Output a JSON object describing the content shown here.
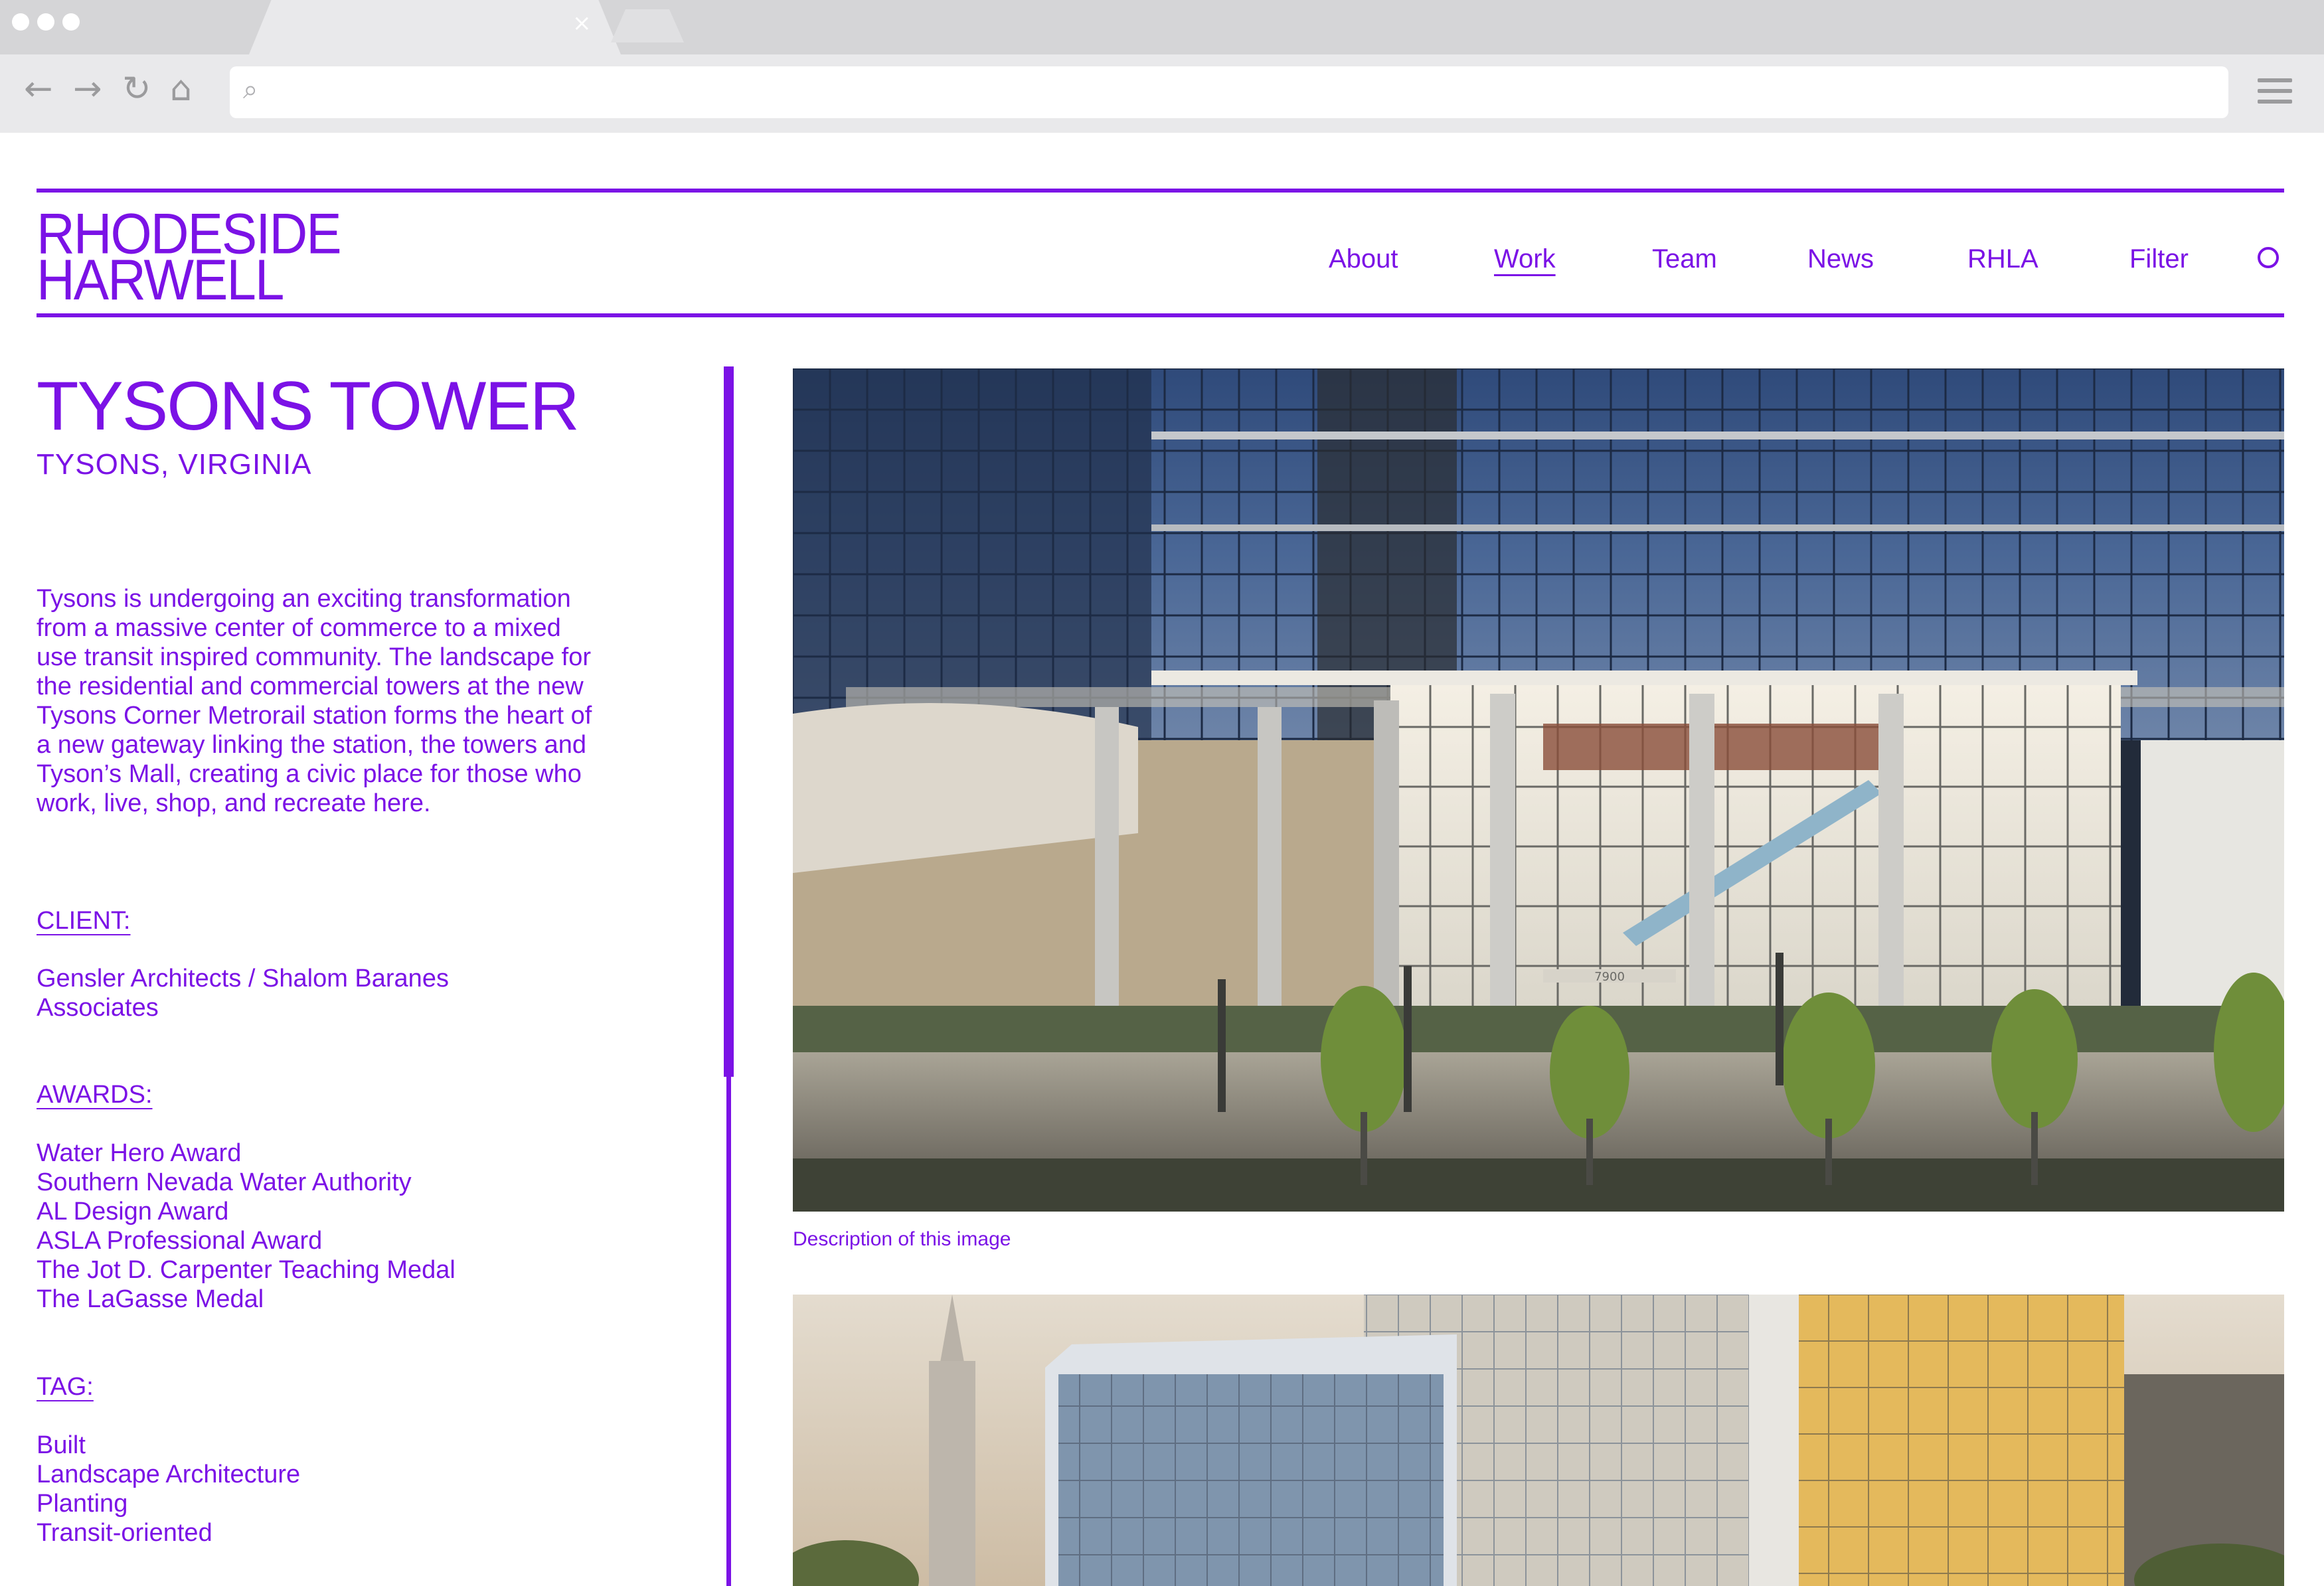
{
  "browser": {
    "tab_close": "×",
    "url_value": "",
    "icons": [
      "back-arrow-icon",
      "forward-arrow-icon",
      "reload-icon",
      "home-icon",
      "search-icon",
      "hamburger-menu-icon"
    ]
  },
  "site": {
    "brand_color": "#7b12e6",
    "logo_line1": "RHODESIDE",
    "logo_line2": "HARWELL",
    "nav": [
      "About",
      "Work",
      "Team",
      "News",
      "RHLA",
      "Filter"
    ],
    "nav_active": "Work"
  },
  "project": {
    "title": "TYSONS TOWER",
    "location": "TYSONS, VIRGINIA",
    "description": "Tysons is undergoing an exciting transformation from a massive center of commerce to a mixed use transit inspired community. The landscape for the residential and commercial towers at the new Tysons Corner Metrorail station forms the heart of a new gateway linking the station, the towers and Tyson’s Mall, creating a civic place for those who work, live, shop, and recreate here.",
    "client_label": "CLIENT:",
    "client_lines": [
      "Gensler Architects / Shalom Baranes",
      "Associates"
    ],
    "awards_label": "AWARDS:",
    "awards": [
      "Water Hero Award",
      "Southern Nevada Water Authority",
      "AL Design Award",
      "ASLA Professional Award",
      "The Jot D. Carpenter Teaching Medal",
      "The LaGasse Medal"
    ],
    "tag_label": "TAG:",
    "tags": [
      "Built",
      "Landscape Architecture",
      "Planting",
      "Transit-oriented"
    ]
  },
  "gallery": {
    "image1_caption": "Description of this image",
    "image1_sign": "7900"
  }
}
